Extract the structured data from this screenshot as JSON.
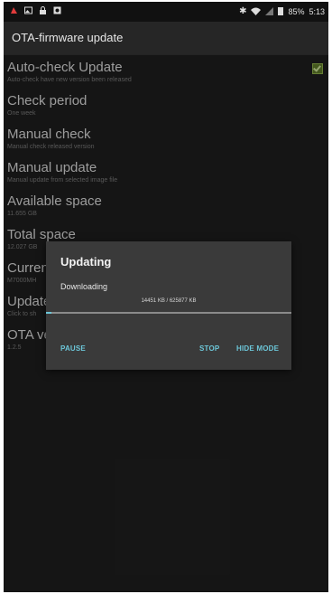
{
  "status_bar": {
    "icons_left": [
      "red-notification-icon",
      "image-icon",
      "lock-icon",
      "record-icon"
    ],
    "icons_right": [
      "bluetooth-icon",
      "wifi-icon",
      "signal-icon",
      "battery-icon"
    ],
    "battery": "85%",
    "time": "5:13"
  },
  "app_bar": {
    "title": "OTA-firmware update"
  },
  "settings": {
    "items": [
      {
        "title": "Auto-check Update",
        "summary": "Auto-check have new version been released",
        "checked": true
      },
      {
        "title": "Check period",
        "summary": "One week"
      },
      {
        "title": "Manual check",
        "summary": "Manual check released version"
      },
      {
        "title": "Manual update",
        "summary": "Manual update from selected image file"
      },
      {
        "title": "Available space",
        "summary": "11.655 GB"
      },
      {
        "title": "Total space",
        "summary": "12.027 GB"
      },
      {
        "title": "Curren",
        "summary": "M7000MH"
      },
      {
        "title": "Update",
        "summary": "Click to sh"
      },
      {
        "title": "OTA ve",
        "summary": "1.2.5"
      }
    ]
  },
  "dialog": {
    "title": "Updating",
    "message": "Downloading",
    "progress_text": "14451 KB / 625877 KB",
    "progress_fraction": 0.023,
    "buttons": {
      "pause": "PAUSE",
      "stop": "STOP",
      "hide": "HIDE MODE"
    }
  },
  "colors": {
    "accent": "#6cc6d8",
    "checkbox": "#8fb04a"
  }
}
